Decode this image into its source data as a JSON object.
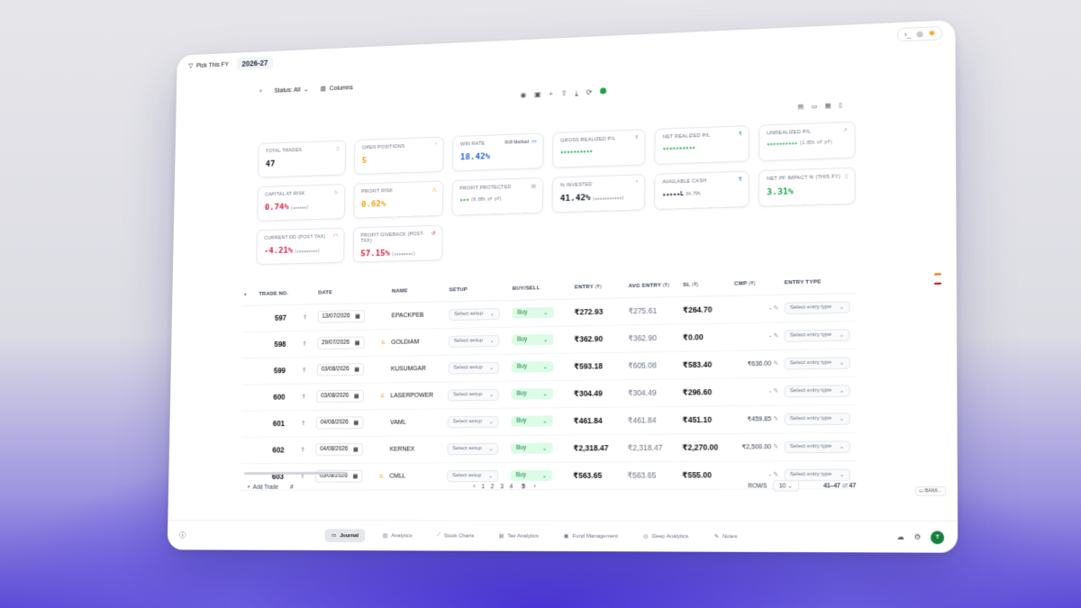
{
  "topbar": {
    "fy_label": "Pick This FY",
    "fy_year": "2026-27",
    "icons": [
      "terminal-icon",
      "compass-icon",
      "sun-icon"
    ]
  },
  "toolbar": {
    "status_label": "Status: All",
    "columns_label": "Columns"
  },
  "cards": {
    "total_trades": {
      "label": "TOTAL TRADES",
      "value": "47"
    },
    "open_positions": {
      "label": "OPEN POSITIONS",
      "value": "5"
    },
    "win_rate": {
      "label": "WIN RATE",
      "value": "18.42%",
      "method": "R:R Method"
    },
    "gross_realized": {
      "label": "GROSS REALIZED P/L",
      "value": "★★★★★★★★★★"
    },
    "net_realized": {
      "label": "NET REALIZED P/L",
      "value": "★★★★★★★★★★"
    },
    "unrealized": {
      "label": "UNREALIZED P/L",
      "value": "★★★★★★★★★★",
      "sub": "(1.85% of pf)"
    },
    "capital_at_risk": {
      "label": "CAPITAL AT RISK",
      "value": "0.74%",
      "sub": "(★★★★★★)"
    },
    "profit_risk": {
      "label": "PROFIT RISK",
      "value": "0.62%"
    },
    "profit_protected": {
      "label": "PROFIT PROTECTED",
      "value": "★★★",
      "sub": "(0.00% of pf)"
    },
    "invested": {
      "label": "% INVESTED",
      "value": "41.42%",
      "sub": "(★★★★★★★★★★★)"
    },
    "available_cash": {
      "label": "AVAILABLE CASH",
      "value": "★★★★★L",
      "sub": "34.79%"
    },
    "net_pf_impact": {
      "label": "NET PF IMPACT % (THIS FY)",
      "value": "3.31%"
    },
    "current_dd": {
      "label": "CURRENT DD (Post-tax)",
      "value": "-4.21%",
      "sub": "(★★★★★★★★★)"
    },
    "profit_giveback": {
      "label": "PROFIT GIVEBACK (Post-tax)",
      "value": "57.15%",
      "sub": "(★★★★★★★★)"
    }
  },
  "table": {
    "headers": {
      "trade_no": "TRADE NO.",
      "date": "DATE",
      "name": "NAME",
      "setup": "SETUP",
      "buy_sell": "BUY/SELL",
      "entry": "ENTRY",
      "avg_entry": "AVG ENTRY",
      "sl": "SL",
      "cmp": "CMP",
      "entry_type": "ENTRY TYPE",
      "currency_hint": "(₹)"
    },
    "rows": [
      {
        "trade_no": "597",
        "date": "13/07/2026",
        "name": "EPACKPEB",
        "setup": "Select setup",
        "side": "Buy",
        "entry": "₹272.93",
        "avg_entry": "₹275.61",
        "sl": "₹264.70",
        "cmp": "-",
        "entry_type": "Select entry type",
        "flag": ""
      },
      {
        "trade_no": "598",
        "date": "29/07/2026",
        "name": "GOLDIAM",
        "setup": "Select setup",
        "side": "Buy",
        "entry": "₹362.90",
        "avg_entry": "₹362.90",
        "sl": "₹0.00",
        "cmp": "-",
        "entry_type": "Select entry type",
        "flag": "E"
      },
      {
        "trade_no": "599",
        "date": "03/08/2026",
        "name": "KUSUMGAR",
        "setup": "Select setup",
        "side": "Buy",
        "entry": "₹593.18",
        "avg_entry": "₹605.08",
        "sl": "₹583.40",
        "cmp": "₹636.00",
        "entry_type": "Select entry type",
        "flag": ""
      },
      {
        "trade_no": "600",
        "date": "03/08/2026",
        "name": "LASERPOWER",
        "setup": "Select setup",
        "side": "Buy",
        "entry": "₹304.49",
        "avg_entry": "₹304.49",
        "sl": "₹296.60",
        "cmp": "-",
        "entry_type": "Select entry type",
        "flag": "E"
      },
      {
        "trade_no": "601",
        "date": "04/08/2026",
        "name": "VAML",
        "setup": "Select setup",
        "side": "Buy",
        "entry": "₹461.84",
        "avg_entry": "₹461.84",
        "sl": "₹451.10",
        "cmp": "₹459.85",
        "entry_type": "Select entry type",
        "flag": ""
      },
      {
        "trade_no": "602",
        "date": "04/08/2026",
        "name": "KERNEX",
        "setup": "Select setup",
        "side": "Buy",
        "entry": "₹2,318.47",
        "avg_entry": "₹2,318.47",
        "sl": "₹2,270.00",
        "cmp": "₹2,500.00",
        "entry_type": "Select entry type",
        "flag": ""
      },
      {
        "trade_no": "603",
        "date": "05/08/2026",
        "name": "CMLL",
        "setup": "Select setup",
        "side": "Buy",
        "entry": "₹563.65",
        "avg_entry": "₹563.65",
        "sl": "₹555.00",
        "cmp": "-",
        "entry_type": "Select entry type",
        "flag": "E"
      }
    ]
  },
  "footer": {
    "add_trade": "Add Trade",
    "hash": "#",
    "pages": [
      "1",
      "2",
      "3",
      "4",
      "5"
    ],
    "current_page": "5",
    "rows_label": "ROWS",
    "rows_value": "10",
    "range": "41–47",
    "of": "of",
    "total": "47"
  },
  "side": {
    "bank_chip": "BANK..."
  },
  "bottom_nav": {
    "tabs": [
      "Journal",
      "Analytics",
      "Stock Charts",
      "Tax Analytics",
      "Fund Management",
      "Deep Analytics",
      "Notes"
    ],
    "active": "Journal",
    "avatar": "T"
  }
}
